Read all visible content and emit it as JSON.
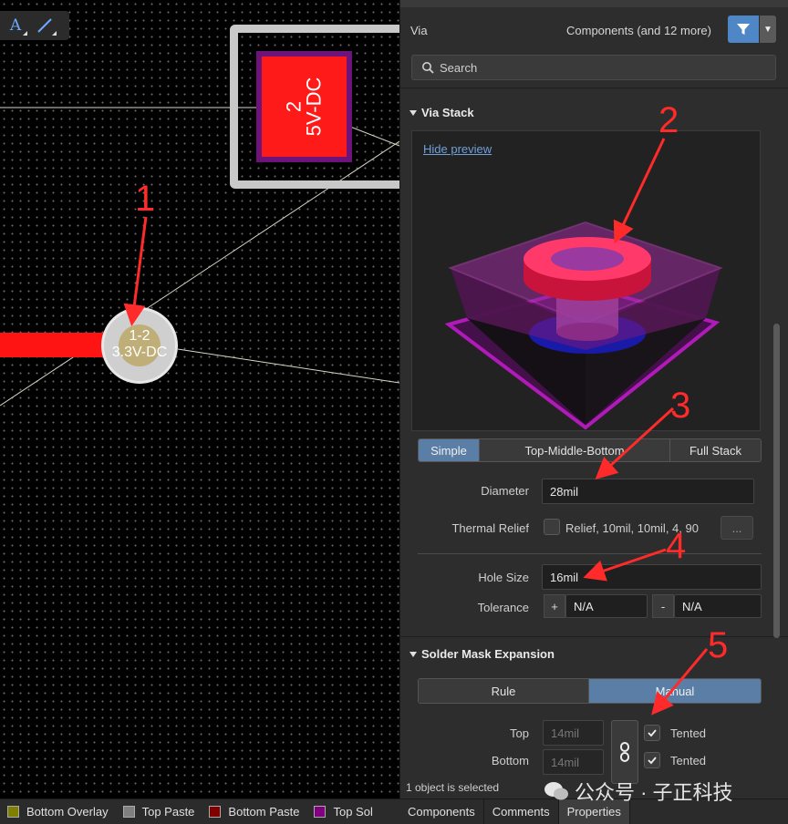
{
  "canvas": {
    "pad_label": "2\n5V-DC",
    "via_label": "1-2\n3.3V-DC"
  },
  "panel": {
    "object_type": "Via",
    "filter_text": "Components (and 12 more)",
    "search_placeholder": "Search",
    "via_stack": {
      "title": "Via Stack",
      "hide_preview": "Hide preview",
      "modes": [
        "Simple",
        "Top-Middle-Bottom",
        "Full Stack"
      ],
      "active_mode": "Simple",
      "diameter_label": "Diameter",
      "diameter_value": "28mil",
      "thermal_relief_label": "Thermal Relief",
      "thermal_relief_value": "Relief, 10mil, 10mil, 4, 90",
      "thermal_relief_button": "...",
      "hole_size_label": "Hole Size",
      "hole_size_value": "16mil",
      "tolerance_label": "Tolerance",
      "tolerance_plus_sign": "+",
      "tolerance_plus": "N/A",
      "tolerance_minus_sign": "-",
      "tolerance_minus": "N/A"
    },
    "solder_mask": {
      "title": "Solder Mask Expansion",
      "modes": [
        "Rule",
        "Manual"
      ],
      "active_mode": "Manual",
      "top_label": "Top",
      "top_value": "14mil",
      "bottom_label": "Bottom",
      "bottom_value": "14mil",
      "top_tented_label": "Tented",
      "top_tented": true,
      "bottom_tented_label": "Tented",
      "bottom_tented": true
    },
    "status": "1 object is selected"
  },
  "layers": [
    {
      "name": "Bottom Overlay",
      "color": "#808000"
    },
    {
      "name": "Top Paste",
      "color": "#808080"
    },
    {
      "name": "Bottom Paste",
      "color": "#800000"
    },
    {
      "name": "Top Sol",
      "color": "#800080"
    }
  ],
  "panel_tabs": [
    {
      "label": "Components",
      "active": false
    },
    {
      "label": "Comments",
      "active": false
    },
    {
      "label": "Properties",
      "active": true
    }
  ],
  "annotations": [
    "1",
    "2",
    "3",
    "4",
    "5"
  ],
  "watermark": "公众号 · 子正科技",
  "colors": {
    "accent": "#4f86c6",
    "annotation": "#ff2a2a",
    "pad": "#ff1a1a",
    "pad_mask": "#6d147a"
  }
}
